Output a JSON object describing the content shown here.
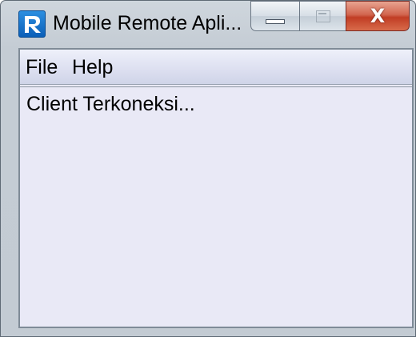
{
  "window": {
    "title": "Mobile Remote Apli...",
    "app_icon": "R-logo-icon",
    "caption_buttons": {
      "minimize_icon": "minimize-icon",
      "maximize_icon": "maximize-icon",
      "close_label": "X"
    }
  },
  "menubar": {
    "items": [
      {
        "label": "File"
      },
      {
        "label": "Help"
      }
    ]
  },
  "content": {
    "status_text": "Client Terkoneksi..."
  },
  "colors": {
    "content_bg": "#e9e9f6",
    "close_button": "#c13d24",
    "app_icon_blue": "#0b5fb8"
  }
}
